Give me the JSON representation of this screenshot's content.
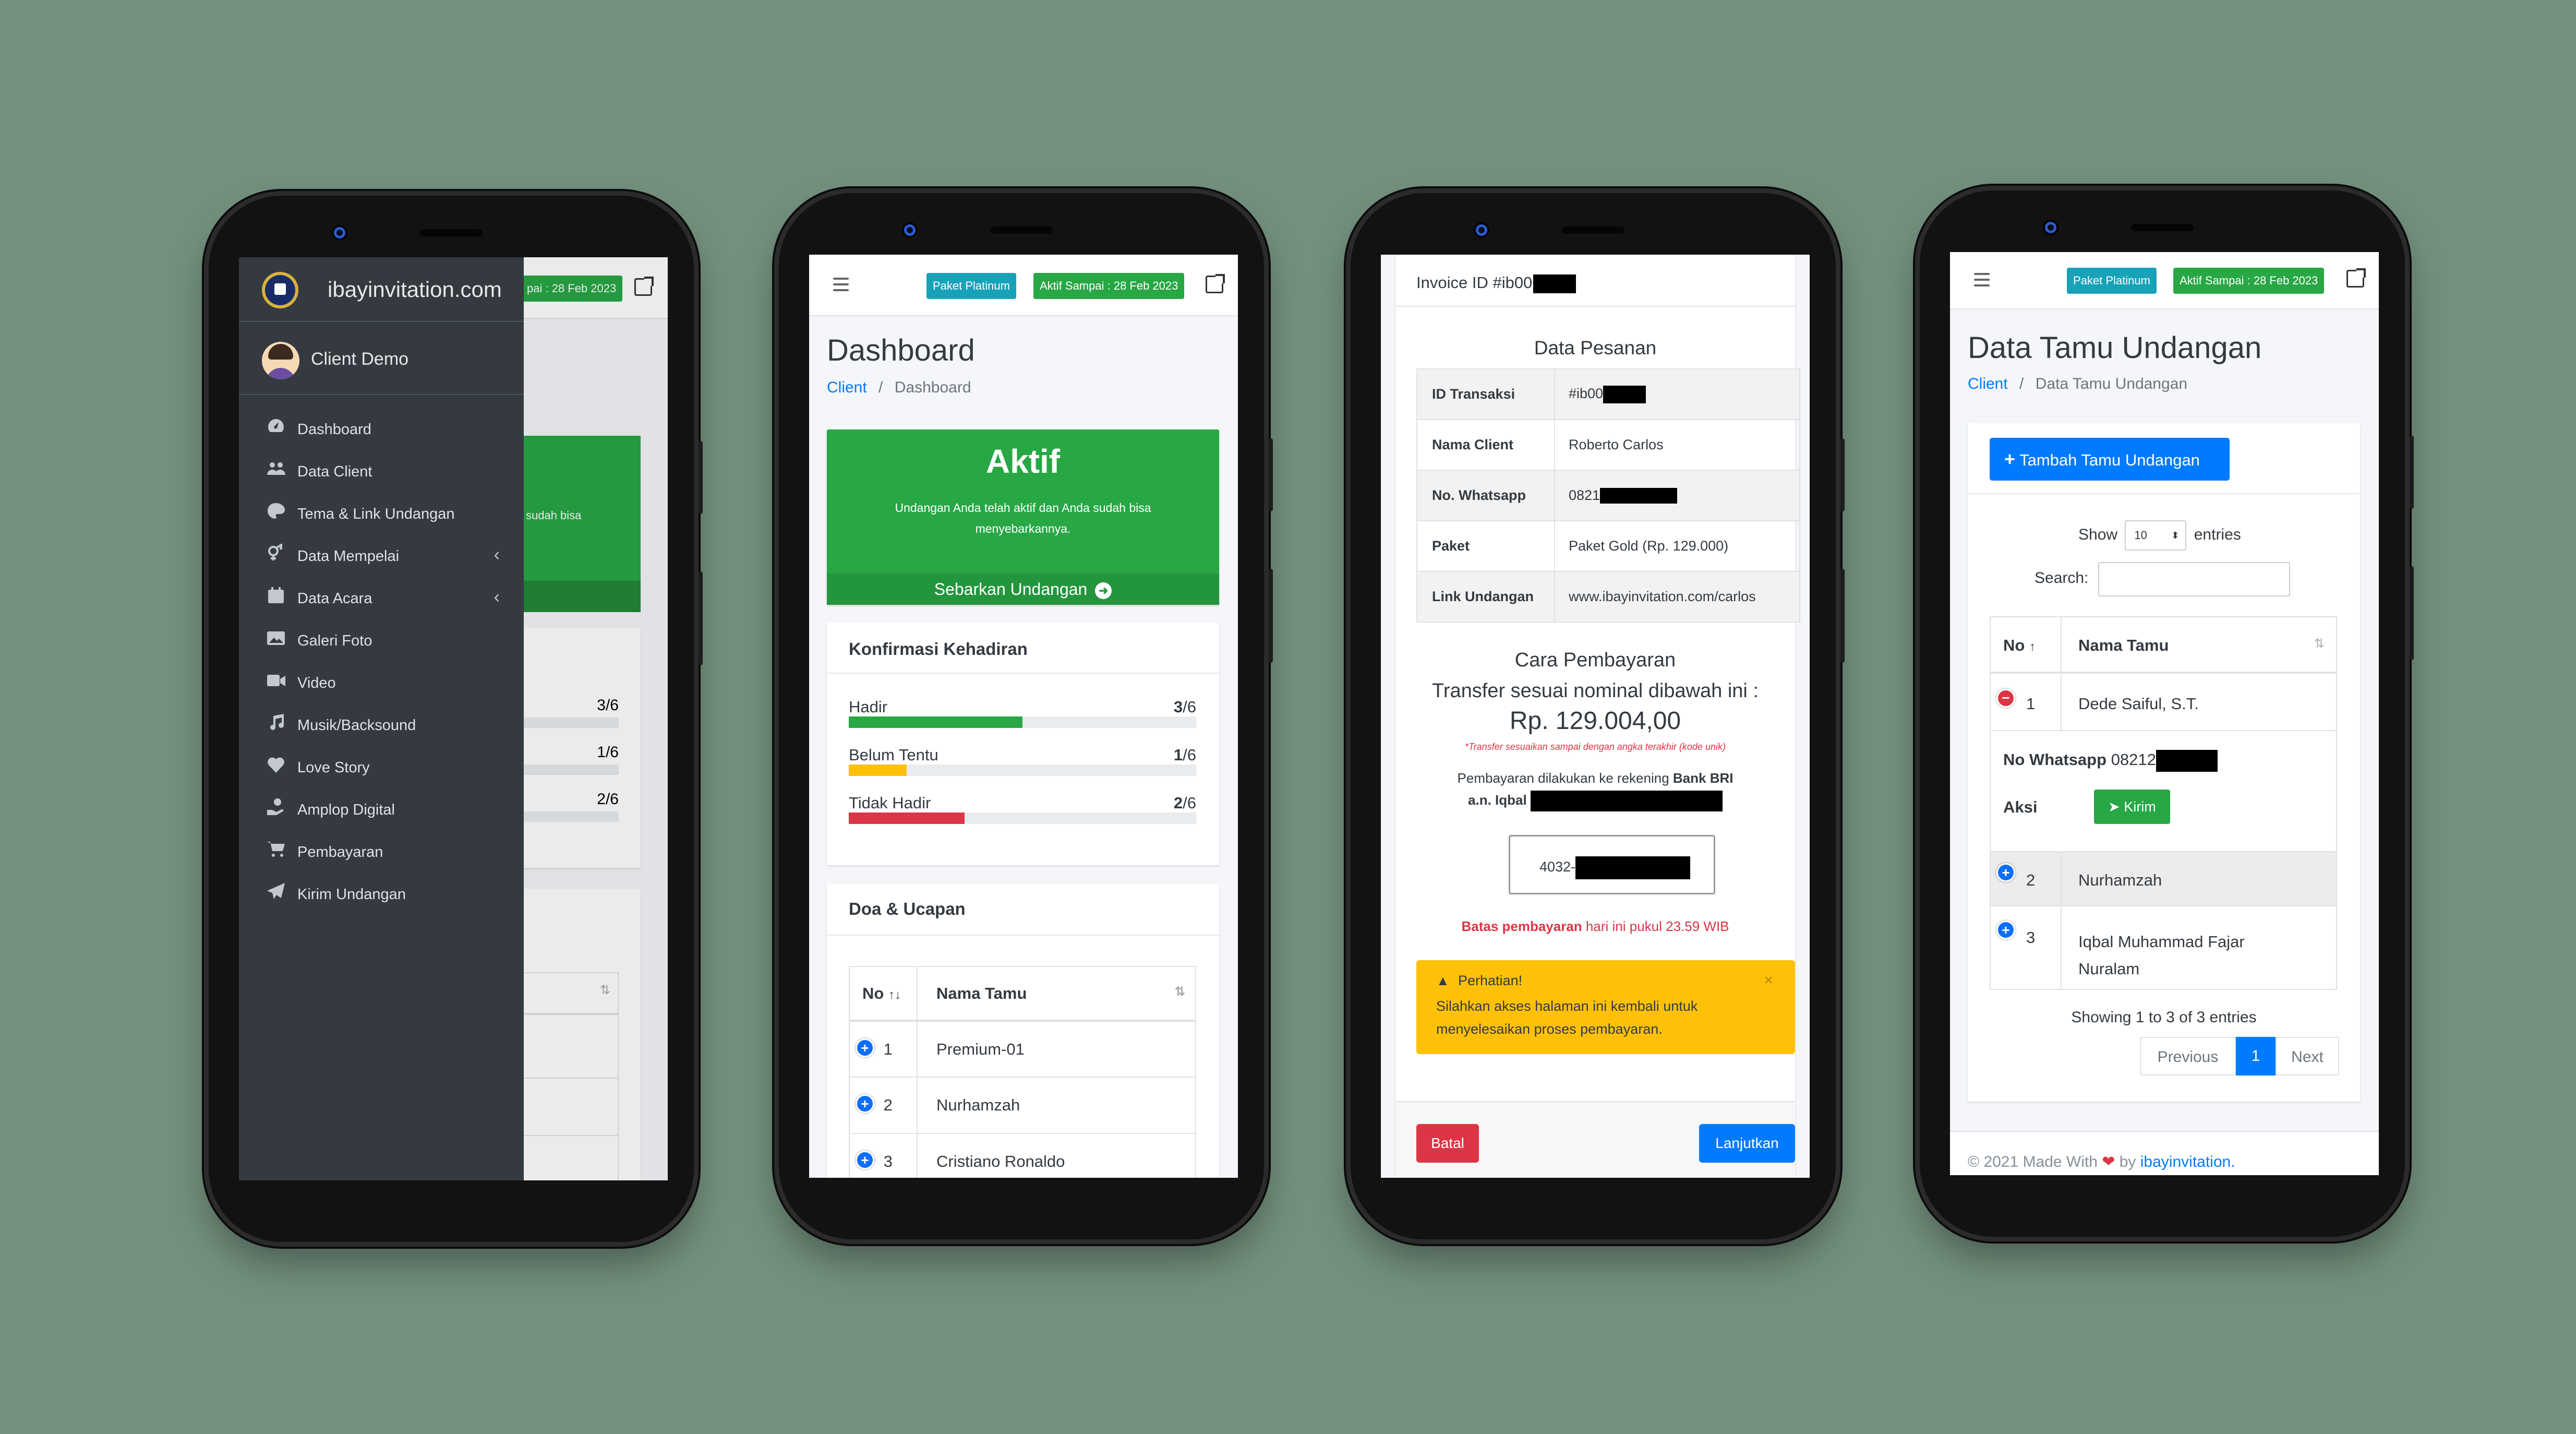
{
  "phone1": {
    "sidebar": {
      "brand": "ibayinvitation.com",
      "user": "Client Demo",
      "items": [
        {
          "label": "Dashboard",
          "icon": "tachometer-icon"
        },
        {
          "label": "Data Client",
          "icon": "users-icon"
        },
        {
          "label": "Tema & Link Undangan",
          "icon": "palette-icon"
        },
        {
          "label": "Data Mempelai",
          "icon": "gender-icon",
          "chevron": "‹"
        },
        {
          "label": "Data Acara",
          "icon": "calendar-icon",
          "chevron": "‹"
        },
        {
          "label": "Galeri Foto",
          "icon": "images-icon"
        },
        {
          "label": "Video",
          "icon": "video-icon"
        },
        {
          "label": "Musik/Backsound",
          "icon": "music-icon"
        },
        {
          "label": "Love Story",
          "icon": "heart-icon"
        },
        {
          "label": "Amplop Digital",
          "icon": "hand-money-icon"
        },
        {
          "label": "Pembayaran",
          "icon": "cart-icon"
        },
        {
          "label": "Kirim Undangan",
          "icon": "paper-plane-icon"
        }
      ]
    },
    "behind": {
      "badge": "pai : 28 Feb 2023",
      "green_text": "sudah bisa",
      "counts": [
        "3/6",
        "1/6",
        "2/6"
      ]
    }
  },
  "phone2": {
    "badges": {
      "paket": "Paket Platinum",
      "aktif": "Aktif Sampai : 28 Feb 2023"
    },
    "title": "Dashboard",
    "breadcrumb": {
      "root": "Client",
      "sep": "/",
      "current": "Dashboard"
    },
    "status_box": {
      "title": "Aktif",
      "text": "Undangan Anda telah aktif dan Anda sudah bisa menyebarkannya.",
      "button": "Sebarkan Undangan"
    },
    "konfirmasi": {
      "title": "Konfirmasi Kehadiran",
      "rows": [
        {
          "label": "Hadir",
          "count": "3",
          "total": "/6",
          "fraction": 0.5,
          "color": "#28a745"
        },
        {
          "label": "Belum Tentu",
          "count": "1",
          "total": "/6",
          "fraction": 0.1667,
          "color": "#ffc107"
        },
        {
          "label": "Tidak Hadir",
          "count": "2",
          "total": "/6",
          "fraction": 0.3333,
          "color": "#dc3545"
        }
      ]
    },
    "doa": {
      "title": "Doa & Ucapan",
      "columns": [
        "No",
        "Nama Tamu"
      ],
      "rows": [
        {
          "no": "1",
          "name": "Premium-01"
        },
        {
          "no": "2",
          "name": "Nurhamzah"
        },
        {
          "no": "3",
          "name": "Cristiano Ronaldo"
        }
      ]
    }
  },
  "phone3": {
    "invoice_label": "Invoice ID #ib00",
    "data_pesanan": "Data Pesanan",
    "rows": [
      {
        "label": "ID Transaksi",
        "value": "#ib00"
      },
      {
        "label": "Nama Client",
        "value": "Roberto Carlos"
      },
      {
        "label": "No. Whatsapp",
        "value": "0821"
      },
      {
        "label": "Paket",
        "value": "Paket Gold (Rp. 129.000)"
      },
      {
        "label": "Link Undangan",
        "value": "www.ibayinvitation.com/carlos"
      }
    ],
    "cara": "Cara Pembayaran",
    "transfer": "Transfer sesuai nominal dibawah ini :",
    "amount": "Rp. 129.004,00",
    "note": "*Transfer sesuaikan sampai dengan angka terakhir (kode unik)",
    "rek_text": "Pembayaran dilakukan ke rekening ",
    "rek_bank": "Bank BRI",
    "an": "a.n. Iqbal",
    "rek_number": "4032-",
    "batas_bold": "Batas pembayaran",
    "batas_rest": " hari ini pukul 23.59 WIB",
    "alert_title": "Perhatian!",
    "alert_text": "Silahkan akses halaman ini kembali untuk menyelesaikan proses pembayaran.",
    "alert_close": "×",
    "btn_batal": "Batal",
    "btn_lanjut": "Lanjutkan"
  },
  "phone4": {
    "badges": {
      "paket": "Paket Platinum",
      "aktif": "Aktif Sampai : 28 Feb 2023"
    },
    "title": "Data Tamu Undangan",
    "breadcrumb": {
      "root": "Client",
      "sep": "/",
      "current": "Data Tamu Undangan"
    },
    "add_button": "Tambah Tamu Undangan",
    "show": "Show",
    "entries_value": "10",
    "entries": "entries",
    "search": "Search:",
    "columns": [
      "No",
      "Nama Tamu"
    ],
    "rows": [
      {
        "no": "1",
        "name": "Dede Saiful, S.T."
      },
      {
        "no": "2",
        "name": "Nurhamzah"
      },
      {
        "no": "3",
        "name": "Iqbal Muhammad Fajar Nuralam"
      }
    ],
    "detail": {
      "wa_label": "No Whatsapp",
      "wa_value": "08212",
      "aksi": "Aksi",
      "kirim": "Kirim"
    },
    "info": "Showing 1 to 3 of 3 entries",
    "pager": {
      "prev": "Previous",
      "page": "1",
      "next": "Next"
    },
    "footer": {
      "text": "© 2021 Made With",
      "by": "by",
      "link": "ibayinvitation."
    }
  }
}
